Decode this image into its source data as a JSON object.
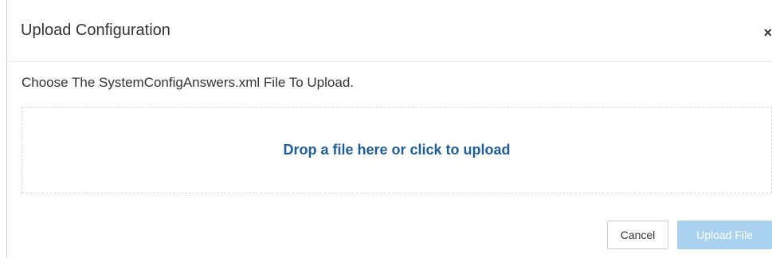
{
  "modal": {
    "title": "Upload Configuration",
    "close_label": "×",
    "instruction": "Choose The SystemConfigAnswers.xml File To Upload.",
    "dropzone_text": "Drop a file here or click to upload"
  },
  "footer": {
    "cancel_label": "Cancel",
    "upload_label": "Upload File",
    "upload_disabled": true
  },
  "colors": {
    "link_text": "#1f5f99",
    "disabled_primary_button": "#a8d2ef",
    "dropzone_border": "#d9d9d9"
  },
  "icons": {
    "close": "close-icon"
  }
}
